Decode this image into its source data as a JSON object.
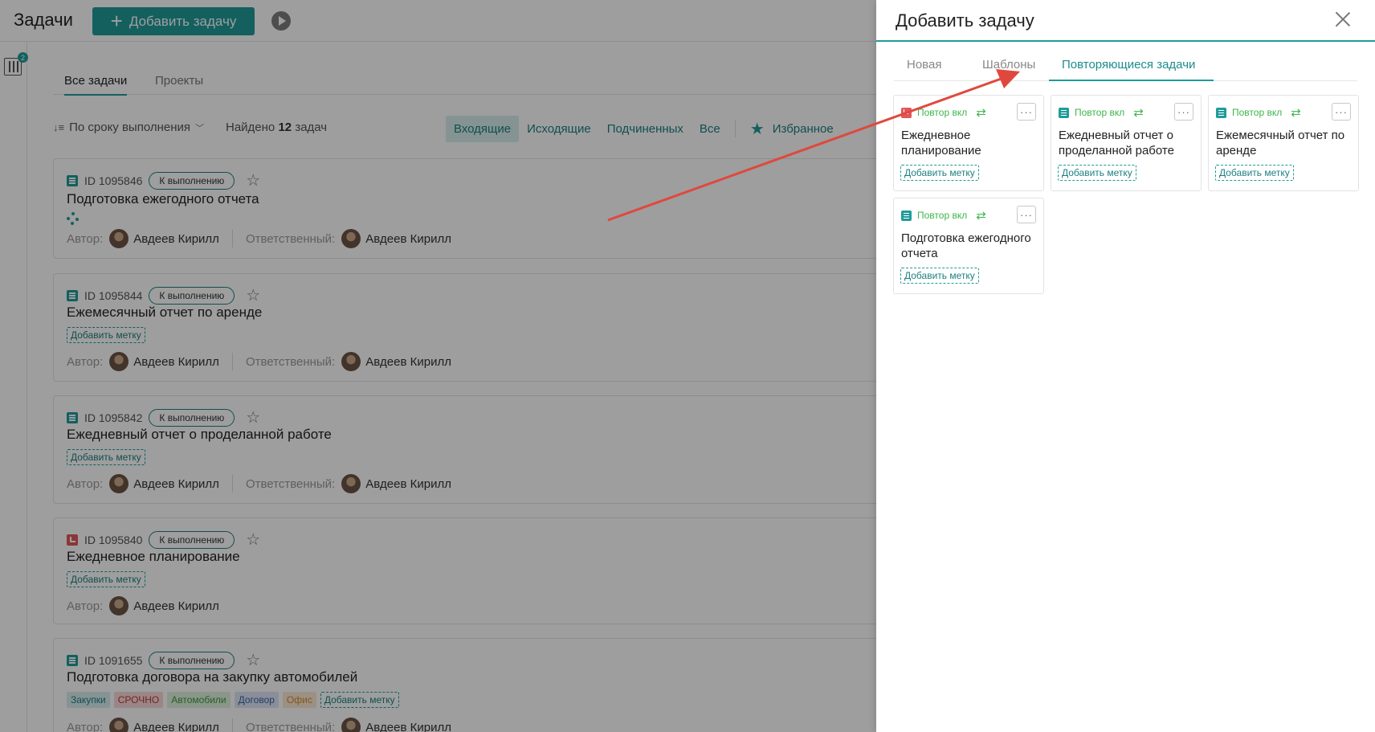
{
  "header": {
    "title": "Задачи",
    "add_button": "Добавить задачу"
  },
  "filter_badge": "2",
  "main_tabs": [
    {
      "label": "Все задачи",
      "active": true
    },
    {
      "label": "Проекты",
      "active": false
    }
  ],
  "toolbar": {
    "sort_label": "По сроку выполнения",
    "found_prefix": "Найдено",
    "found_count": "12",
    "found_suffix": "задач",
    "filters": [
      {
        "label": "Входящие",
        "active": true
      },
      {
        "label": "Исходящие",
        "active": false
      },
      {
        "label": "Подчиненных",
        "active": false
      },
      {
        "label": "Все",
        "active": false
      }
    ],
    "favorites_label": "Избранное"
  },
  "people_labels": {
    "author": "Автор:",
    "responsible": "Ответственный:"
  },
  "tasks": [
    {
      "id": "ID 1095846",
      "status": "К выполнению",
      "title": "Подготовка ежегодного отчета",
      "icon": "list",
      "author": "Авдеев Кирилл",
      "responsible": "Авдеев Кирилл"
    },
    {
      "id": "ID 1095844",
      "status": "К выполнению",
      "title": "Ежемесячный отчет по аренде",
      "icon": "list",
      "add_label": "Добавить метку",
      "author": "Авдеев Кирилл",
      "responsible": "Авдеев Кирилл"
    },
    {
      "id": "ID 1095842",
      "status": "К выполнению",
      "title": "Ежедневный отчет о проделанной работе",
      "icon": "list",
      "add_label": "Добавить метку",
      "author": "Авдеев Кирилл",
      "responsible": "Авдеев Кирилл"
    },
    {
      "id": "ID 1095840",
      "status": "К выполнению",
      "title": "Ежедневное планирование",
      "icon": "clock",
      "add_label": "Добавить метку",
      "author": "Авдеев Кирилл"
    },
    {
      "id": "ID 1091655",
      "status": "К выполнению",
      "title": "Подготовка договора на закупку автомобилей",
      "icon": "list",
      "tags": [
        {
          "label": "Закупки",
          "color": "#d9eef0",
          "text": "#1e7f80"
        },
        {
          "label": "СРОЧНО",
          "color": "#f8d9dc",
          "text": "#c0392b"
        },
        {
          "label": "Автомобили",
          "color": "#dff2df",
          "text": "#3c9a3c"
        },
        {
          "label": "Договор",
          "color": "#dde6f5",
          "text": "#3a62a8"
        },
        {
          "label": "Офис",
          "color": "#fbe9d5",
          "text": "#d48b2c"
        }
      ],
      "add_label": "Добавить метку",
      "author": "Авдеев Кирилл",
      "responsible": "Авдеев Кирилл"
    }
  ],
  "drawer": {
    "title": "Добавить задачу",
    "tabs": [
      {
        "label": "Новая",
        "active": false
      },
      {
        "label": "Шаблоны",
        "active": false
      },
      {
        "label": "Повторяющиеся задачи",
        "active": true
      }
    ],
    "recurring": [
      {
        "icon": "clock",
        "repeat": "Повтор вкл",
        "title": "Ежедневное планирование",
        "add_label": "Добавить метку"
      },
      {
        "icon": "list",
        "repeat": "Повтор вкл",
        "title": "Ежедневный отчет о проделанной работе",
        "add_label": "Добавить метку"
      },
      {
        "icon": "list",
        "repeat": "Повтор вкл",
        "title": "Ежемесячный отчет по аренде",
        "add_label": "Добавить метку"
      },
      {
        "icon": "list",
        "repeat": "Повтор вкл",
        "title": "Подготовка ежегодного отчета",
        "add_label": "Добавить метку"
      }
    ],
    "more_glyph": "···"
  },
  "colors": {
    "accent": "#1f9c9a",
    "arrow": "#e0483e"
  }
}
